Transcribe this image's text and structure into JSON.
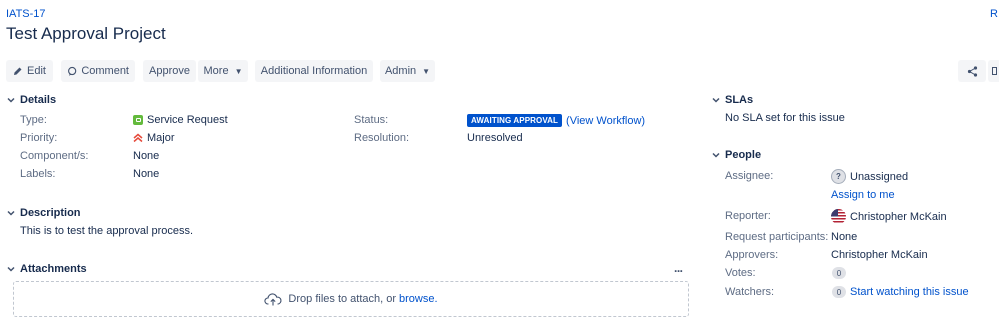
{
  "header": {
    "issue_key": "IATS-17",
    "top_right_link": "R",
    "title": "Test Approval Project"
  },
  "toolbar": {
    "edit": "Edit",
    "comment": "Comment",
    "approve": "Approve",
    "more": "More",
    "additional_information": "Additional Information",
    "admin": "Admin"
  },
  "details": {
    "heading": "Details",
    "type_label": "Type:",
    "type_value": "Service Request",
    "priority_label": "Priority:",
    "priority_value": "Major",
    "components_label": "Component/s:",
    "components_value": "None",
    "labels_label": "Labels:",
    "labels_value": "None",
    "status_label": "Status:",
    "status_value": "AWAITING APPROVAL",
    "view_workflow": "(View Workflow)",
    "resolution_label": "Resolution:",
    "resolution_value": "Unresolved"
  },
  "description": {
    "heading": "Description",
    "text": "This is to test the approval process."
  },
  "attachments": {
    "heading": "Attachments",
    "more_icon": "...",
    "drop_text": "Drop files to attach, or",
    "browse": "browse."
  },
  "slas": {
    "heading": "SLAs",
    "text": "No SLA set for this issue"
  },
  "people": {
    "heading": "People",
    "assignee_label": "Assignee:",
    "assignee_value": "Unassigned",
    "assign_to_me": "Assign to me",
    "reporter_label": "Reporter:",
    "reporter_value": "Christopher McKain",
    "participants_label": "Request participants:",
    "participants_value": "None",
    "approvers_label": "Approvers:",
    "approvers_value": "Christopher McKain",
    "votes_label": "Votes:",
    "votes_count": "0",
    "watchers_label": "Watchers:",
    "watchers_count": "0",
    "start_watching": "Start watching this issue"
  },
  "colors": {
    "link": "#0052cc",
    "lozenge": "#0052cc",
    "button_bg": "#f4f5f7",
    "service_request_icon": "#63ba3c",
    "priority_major": "#e5493a"
  }
}
